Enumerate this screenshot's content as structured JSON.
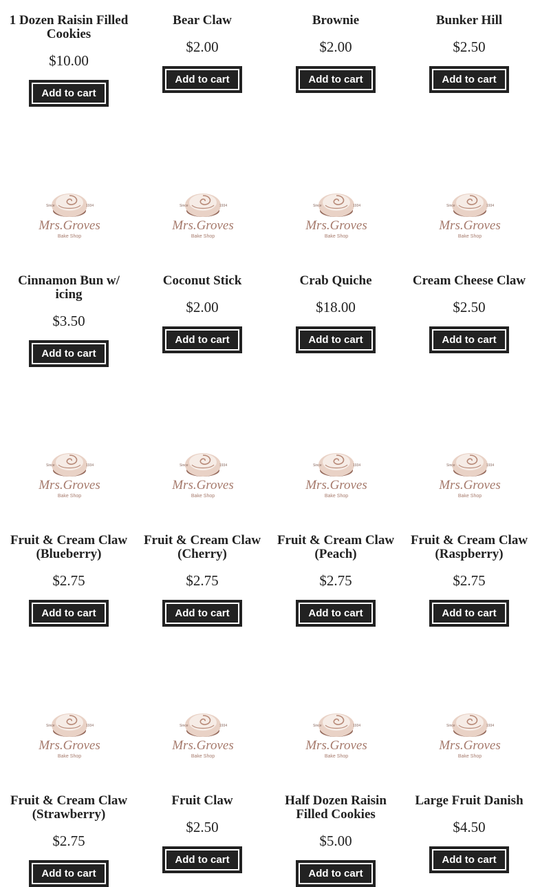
{
  "logo": {
    "since": "Since",
    "year": "1934",
    "brand": "Mrs.Groves",
    "tagline": "Bake Shop"
  },
  "products": [
    {
      "name": "1 Dozen Raisin Filled Cookies",
      "price": "$10.00",
      "button": "Add to cart"
    },
    {
      "name": "Bear Claw",
      "price": "$2.00",
      "button": "Add to cart"
    },
    {
      "name": "Brownie",
      "price": "$2.00",
      "button": "Add to cart"
    },
    {
      "name": "Bunker Hill",
      "price": "$2.50",
      "button": "Add to cart"
    },
    {
      "name": "Cinnamon Bun w/ icing",
      "price": "$3.50",
      "button": "Add to cart"
    },
    {
      "name": "Coconut Stick",
      "price": "$2.00",
      "button": "Add to cart"
    },
    {
      "name": "Crab Quiche",
      "price": "$18.00",
      "button": "Add to cart"
    },
    {
      "name": "Cream Cheese Claw",
      "price": "$2.50",
      "button": "Add to cart"
    },
    {
      "name": "Fruit & Cream Claw (Blueberry)",
      "price": "$2.75",
      "button": "Add to cart"
    },
    {
      "name": "Fruit & Cream Claw (Cherry)",
      "price": "$2.75",
      "button": "Add to cart"
    },
    {
      "name": "Fruit & Cream Claw (Peach)",
      "price": "$2.75",
      "button": "Add to cart"
    },
    {
      "name": "Fruit & Cream Claw (Raspberry)",
      "price": "$2.75",
      "button": "Add to cart"
    },
    {
      "name": "Fruit & Cream Claw (Strawberry)",
      "price": "$2.75",
      "button": "Add to cart"
    },
    {
      "name": "Fruit Claw",
      "price": "$2.50",
      "button": "Add to cart"
    },
    {
      "name": "Half Dozen Raisin Filled Cookies",
      "price": "$5.00",
      "button": "Add to cart"
    },
    {
      "name": "Large Fruit Danish",
      "price": "$4.50",
      "button": "Add to cart"
    }
  ]
}
